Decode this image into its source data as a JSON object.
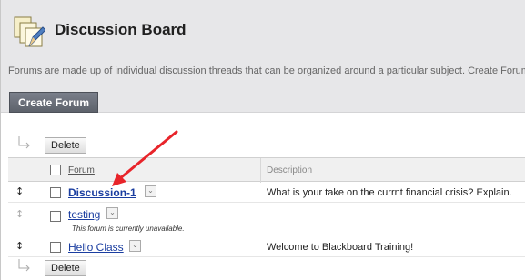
{
  "header": {
    "title": "Discussion Board",
    "description": "Forums are made up of individual discussion threads that can be organized around a particular subject. Create Forums to organize discussions.",
    "create_button": "Create Forum"
  },
  "toolbar": {
    "delete_label": "Delete"
  },
  "table": {
    "headers": {
      "forum": "Forum",
      "description": "Description"
    },
    "rows": [
      {
        "name": "Discussion-1",
        "description": "What is your take on the currnt financial crisis? Explain.",
        "note": ""
      },
      {
        "name": "testing",
        "description": "",
        "note": "This forum is currently unavailable."
      },
      {
        "name": "Hello Class",
        "description": "Welcome to Blackboard Training!",
        "note": ""
      }
    ]
  },
  "colors": {
    "header_bg": "#e7e7e9",
    "button_bg": "#666b75",
    "link": "#1a3da0",
    "annotation_arrow": "#e8242a"
  },
  "icons": {
    "title": "discussion-board-icon",
    "row_action": "chevron-down-icon",
    "drag": "drag-handle-icon",
    "toolbar": "pipe-arrow-icon"
  }
}
